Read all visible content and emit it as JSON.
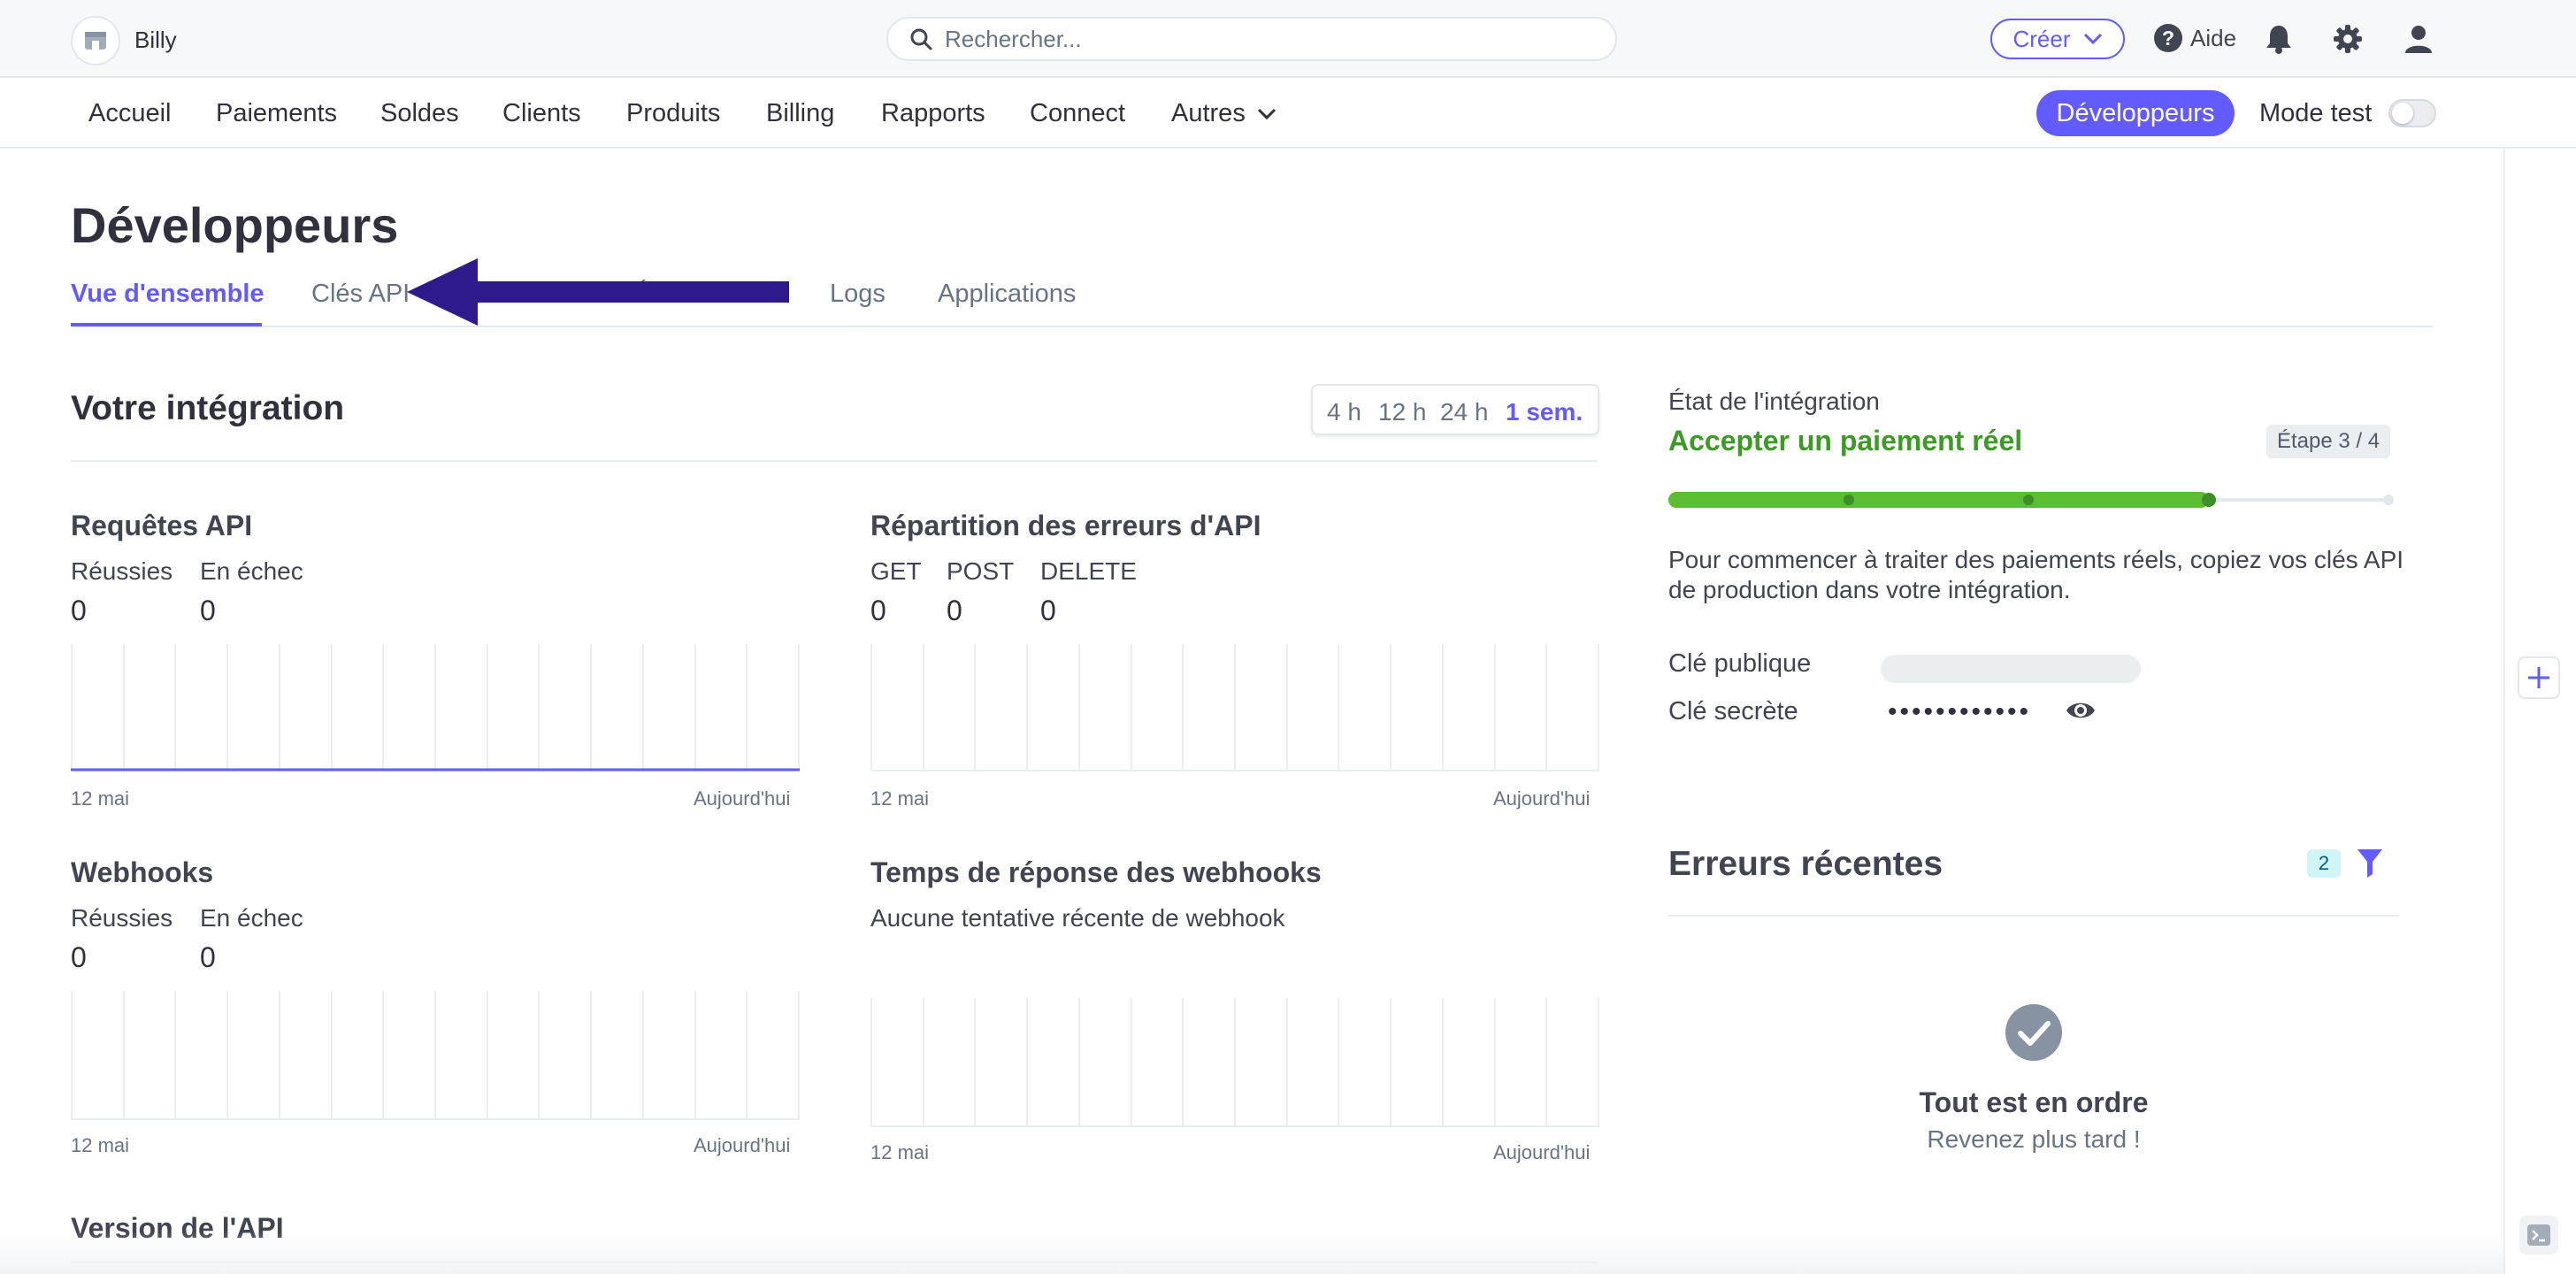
{
  "account": {
    "name": "Billy"
  },
  "search": {
    "placeholder": "Rechercher..."
  },
  "topbar": {
    "create_label": "Créer",
    "help_label": "Aide"
  },
  "nav": {
    "items": [
      "Accueil",
      "Paiements",
      "Soldes",
      "Clients",
      "Produits",
      "Billing",
      "Rapports",
      "Connect",
      "Autres"
    ],
    "developers_label": "Développeurs",
    "test_mode_label": "Mode test",
    "test_mode_on": false
  },
  "page": {
    "title": "Développeurs",
    "tabs": [
      "Vue d'ensemble",
      "Clés API",
      "Webhooks",
      "Événements",
      "Logs",
      "Applications"
    ],
    "active_tab": "Vue d'ensemble"
  },
  "integration": {
    "title": "Votre intégration",
    "ranges": [
      "4 h",
      "12 h",
      "24 h",
      "1 sem."
    ],
    "selected_range": "1 sem."
  },
  "cards": {
    "api_requests": {
      "title": "Requêtes API",
      "labels": [
        "Réussies",
        "En échec"
      ],
      "values": [
        "0",
        "0"
      ],
      "x_start": "12 mai",
      "x_end": "Aujourd'hui"
    },
    "api_errors": {
      "title": "Répartition des erreurs d'API",
      "labels": [
        "GET",
        "POST",
        "DELETE"
      ],
      "values": [
        "0",
        "0",
        "0"
      ],
      "x_start": "12 mai",
      "x_end": "Aujourd'hui"
    },
    "webhooks": {
      "title": "Webhooks",
      "labels": [
        "Réussies",
        "En échec"
      ],
      "values": [
        "0",
        "0"
      ],
      "x_start": "12 mai",
      "x_end": "Aujourd'hui"
    },
    "webhook_response": {
      "title": "Temps de réponse des webhooks",
      "empty_text": "Aucune tentative récente de webhook",
      "x_start": "12 mai",
      "x_end": "Aujourd'hui"
    }
  },
  "integration_status": {
    "title": "État de l'intégration",
    "step_title": "Accepter un paiement réel",
    "step_badge": "Étape 3 / 4",
    "progress": 0.75,
    "colors": {
      "done": "#5cbc32",
      "pending": "#e3e8ee"
    },
    "description": "Pour commencer à traiter des paiements réels, copiez vos clés API de production dans votre intégration.",
    "public_key_label": "Clé publique",
    "secret_key_label": "Clé secrète",
    "secret_key_masked": "••••••••••••"
  },
  "recent_errors": {
    "title": "Erreurs récentes",
    "count": "2",
    "empty_title": "Tout est en ordre",
    "empty_subtitle": "Revenez plus tard !"
  },
  "api_version": {
    "title": "Version de l'API"
  },
  "colors": {
    "accent": "#635bff",
    "success": "#3b9b25",
    "text": "#30313d"
  },
  "chart_data": [
    {
      "type": "line",
      "title": "Requêtes API",
      "x_range": [
        "12 mai",
        "Aujourd'hui"
      ],
      "series": [
        {
          "name": "Réussies",
          "values": [
            0,
            0,
            0,
            0,
            0,
            0,
            0,
            0,
            0,
            0,
            0,
            0,
            0,
            0,
            0
          ]
        }
      ],
      "grid": true
    },
    {
      "type": "bar",
      "title": "Répartition des erreurs d'API",
      "x_range": [
        "12 mai",
        "Aujourd'hui"
      ],
      "categories": [
        "GET",
        "POST",
        "DELETE"
      ],
      "values": [
        0,
        0,
        0
      ],
      "grid": true
    },
    {
      "type": "line",
      "title": "Webhooks",
      "x_range": [
        "12 mai",
        "Aujourd'hui"
      ],
      "series": [],
      "grid": true
    },
    {
      "type": "line",
      "title": "Temps de réponse des webhooks",
      "x_range": [
        "12 mai",
        "Aujourd'hui"
      ],
      "series": [],
      "grid": true
    }
  ]
}
